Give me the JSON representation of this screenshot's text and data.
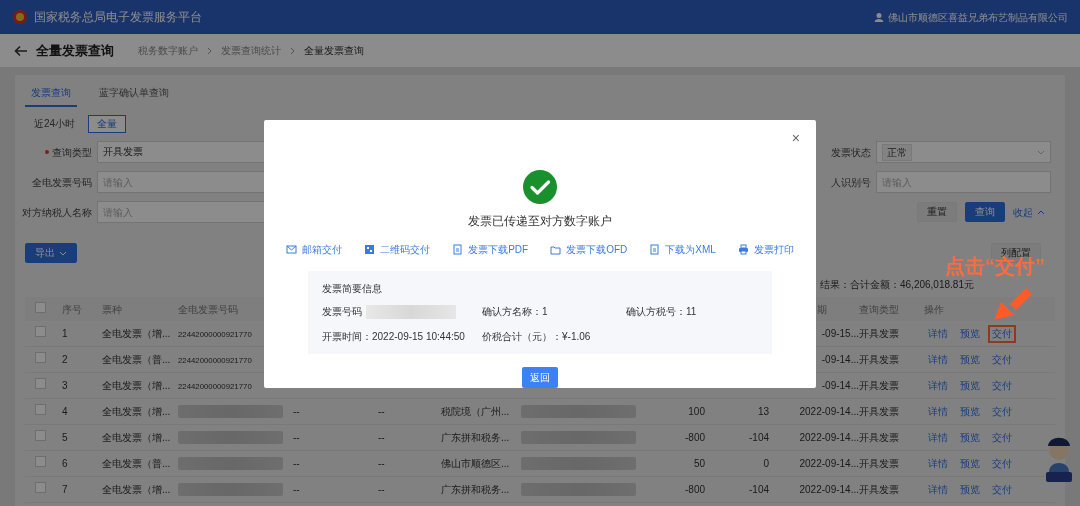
{
  "header": {
    "title": "国家税务总局电子发票服务平台",
    "user": "佛山市顺德区喜益兄弟布艺制品有限公司"
  },
  "page": {
    "title": "全量发票查询",
    "breadcrumb": [
      "税务数字账户",
      "发票查询统计",
      "全量发票查询"
    ]
  },
  "tabs": [
    {
      "label": "发票查询",
      "selected": true
    },
    {
      "label": "蓝字确认单查询",
      "selected": false
    }
  ],
  "ranges": [
    {
      "label": "近24小时",
      "selected": false
    },
    {
      "label": "全量",
      "selected": true
    }
  ],
  "filters_left": [
    {
      "label": "查询类型",
      "required": true,
      "value": "开具发票"
    },
    {
      "label": "全电发票号码",
      "required": false,
      "placeholder": "请输入"
    },
    {
      "label": "对方纳税人名称",
      "required": false,
      "placeholder": "请输入"
    }
  ],
  "filters_right": [
    {
      "label": "发票状态",
      "tag": "正常"
    },
    {
      "label": "人识别号",
      "placeholder": "请输入"
    }
  ],
  "filter_buttons": {
    "reset": "重置",
    "search": "查询",
    "collapse": "收起"
  },
  "export_button": "导出",
  "column_button": "列配置",
  "summary": "结果：合计金额：46,206,018.81元",
  "table": {
    "select_all_checked": false,
    "columns": [
      "序号",
      "票种",
      "全电发票号码",
      "期",
      "查询类型",
      "操作"
    ],
    "rows": [
      {
        "checked": false,
        "seq": "1",
        "type": "全电发票（增...",
        "number": "22442000000921770",
        "date": "-09-15...",
        "query_type": "开具发票",
        "actions": [
          {
            "label": "详情",
            "highlighted": false
          },
          {
            "label": "预览",
            "highlighted": false
          },
          {
            "label": "交付",
            "highlighted": true
          }
        ]
      },
      {
        "checked": false,
        "seq": "2",
        "type": "全电发票（普...",
        "number": "22442000000921770",
        "date": "-09-14...",
        "query_type": "开具发票",
        "actions": [
          {
            "label": "详情",
            "highlighted": false
          },
          {
            "label": "预览",
            "highlighted": false
          },
          {
            "label": "交付",
            "highlighted": false
          }
        ]
      },
      {
        "checked": false,
        "seq": "3",
        "type": "全电发票（增...",
        "number": "22442000000921770",
        "date": "-09-14...",
        "query_type": "开具发票",
        "actions": [
          {
            "label": "详情",
            "highlighted": false
          },
          {
            "label": "预览",
            "highlighted": false
          },
          {
            "label": "交付",
            "highlighted": false
          }
        ]
      },
      {
        "checked": false,
        "seq": "4",
        "type": "全电发票（增...",
        "number_hidden": true,
        "column_4": "--",
        "column_5": "--",
        "buyer": "税院境（广州...",
        "column_8_hidden": true,
        "amount": "100",
        "tax": "13",
        "date": "2022-09-14...",
        "query_type": "开具发票",
        "actions": [
          {
            "label": "详情",
            "highlighted": false
          },
          {
            "label": "预览",
            "highlighted": false
          },
          {
            "label": "交付",
            "highlighted": false
          }
        ]
      },
      {
        "checked": false,
        "seq": "5",
        "type": "全电发票（增...",
        "number_hidden": true,
        "column_4": "--",
        "column_5": "--",
        "buyer": "广东拼和税务...",
        "column_8_hidden": true,
        "amount": "-800",
        "tax": "-104",
        "date": "2022-09-14...",
        "query_type": "开具发票",
        "actions": [
          {
            "label": "详情",
            "highlighted": false
          },
          {
            "label": "预览",
            "highlighted": false
          },
          {
            "label": "交付",
            "highlighted": false
          }
        ]
      },
      {
        "checked": false,
        "seq": "6",
        "type": "全电发票（普...",
        "number_hidden": true,
        "column_4": "--",
        "column_5": "--",
        "buyer": "佛山市顺德区...",
        "column_8_hidden": true,
        "amount": "50",
        "tax": "0",
        "date": "2022-09-14...",
        "query_type": "开具发票",
        "actions": [
          {
            "label": "详情",
            "highlighted": false
          },
          {
            "label": "预览",
            "highlighted": false
          },
          {
            "label": "交付",
            "highlighted": false
          }
        ]
      },
      {
        "checked": false,
        "seq": "7",
        "type": "全电发票（增...",
        "number_hidden": true,
        "column_4": "--",
        "column_5": "--",
        "buyer": "广东拼和税务...",
        "column_8_hidden": true,
        "amount": "-800",
        "tax": "-104",
        "date": "2022-09-14...",
        "query_type": "开具发票",
        "actions": [
          {
            "label": "详情",
            "highlighted": false
          },
          {
            "label": "预览",
            "highlighted": false
          },
          {
            "label": "交付",
            "highlighted": false
          }
        ]
      }
    ]
  },
  "dialog": {
    "close": "×",
    "title": "发票已传递至对方数字账户",
    "actions": [
      "邮箱交付",
      "二维码交付",
      "发票下载PDF",
      "发票下载OFD",
      "下载为XML",
      "发票打印"
    ],
    "info": {
      "heading": "发票简要信息",
      "fields": [
        {
          "label": "发票号码",
          "value_hidden": true
        },
        {
          "label": "确认方名称：",
          "value": "1"
        },
        {
          "label": "确认方税号：",
          "value": "11"
        },
        {
          "label": "开票时间：",
          "value": "2022-09-15 10:44:50"
        },
        {
          "label": "价税合计（元）：",
          "value": "¥-1.06"
        }
      ]
    },
    "button": "返回"
  },
  "annotation": {
    "text": "点击“交付”"
  }
}
